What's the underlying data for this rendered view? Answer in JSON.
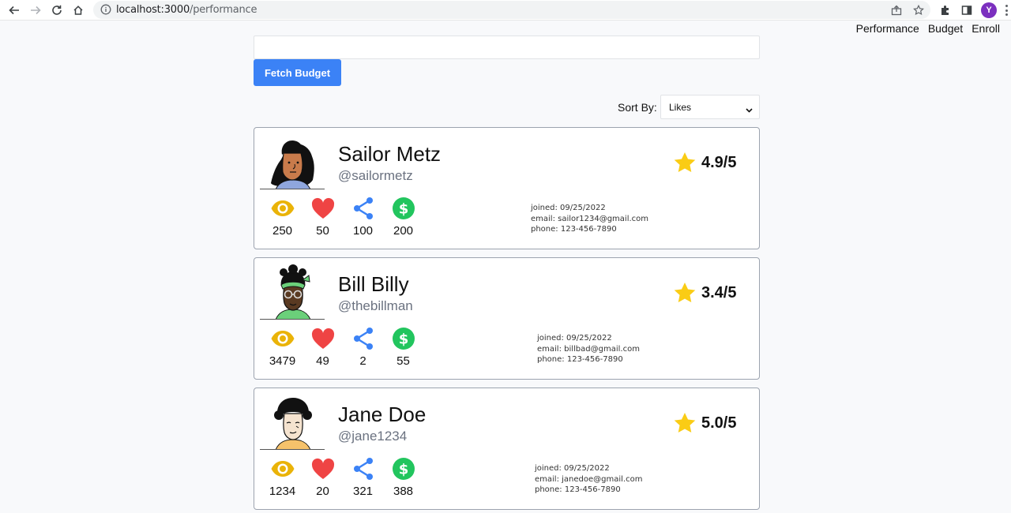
{
  "browser": {
    "url_host": "localhost:3000",
    "url_path": "/performance",
    "profile_initial": "Y"
  },
  "nav": {
    "items": [
      "Performance",
      "Budget",
      "Enroll"
    ]
  },
  "controls": {
    "budget_input_value": "",
    "fetch_button_label": "Fetch Budget",
    "sort_label": "Sort By:",
    "sort_selected": "Likes"
  },
  "colors": {
    "primary_button": "#3b82f6",
    "views_icon": "#eab308",
    "likes_icon": "#ef4444",
    "shares_icon": "#3b82f6",
    "earnings_icon": "#22c55e",
    "star": "#facc15"
  },
  "icons": [
    "eye-icon",
    "heart-icon",
    "share-icon",
    "dollar-icon",
    "star-icon"
  ],
  "users": [
    {
      "name": "Sailor Metz",
      "handle": "@sailormetz",
      "rating": "4.9/5",
      "views": "250",
      "likes": "50",
      "shares": "100",
      "earnings": "200",
      "joined": "joined: 09/25/2022",
      "email": "email: sailor1234@gmail.com",
      "phone": "phone: 123-456-7890"
    },
    {
      "name": "Bill Billy",
      "handle": "@thebillman",
      "rating": "3.4/5",
      "views": "3479",
      "likes": "49",
      "shares": "2",
      "earnings": "55",
      "joined": "joined: 09/25/2022",
      "email": "email: billbad@gmail.com",
      "phone": "phone: 123-456-7890"
    },
    {
      "name": "Jane Doe",
      "handle": "@jane1234",
      "rating": "5.0/5",
      "views": "1234",
      "likes": "20",
      "shares": "321",
      "earnings": "388",
      "joined": "joined: 09/25/2022",
      "email": "email: janedoe@gmail.com",
      "phone": "phone: 123-456-7890"
    }
  ]
}
